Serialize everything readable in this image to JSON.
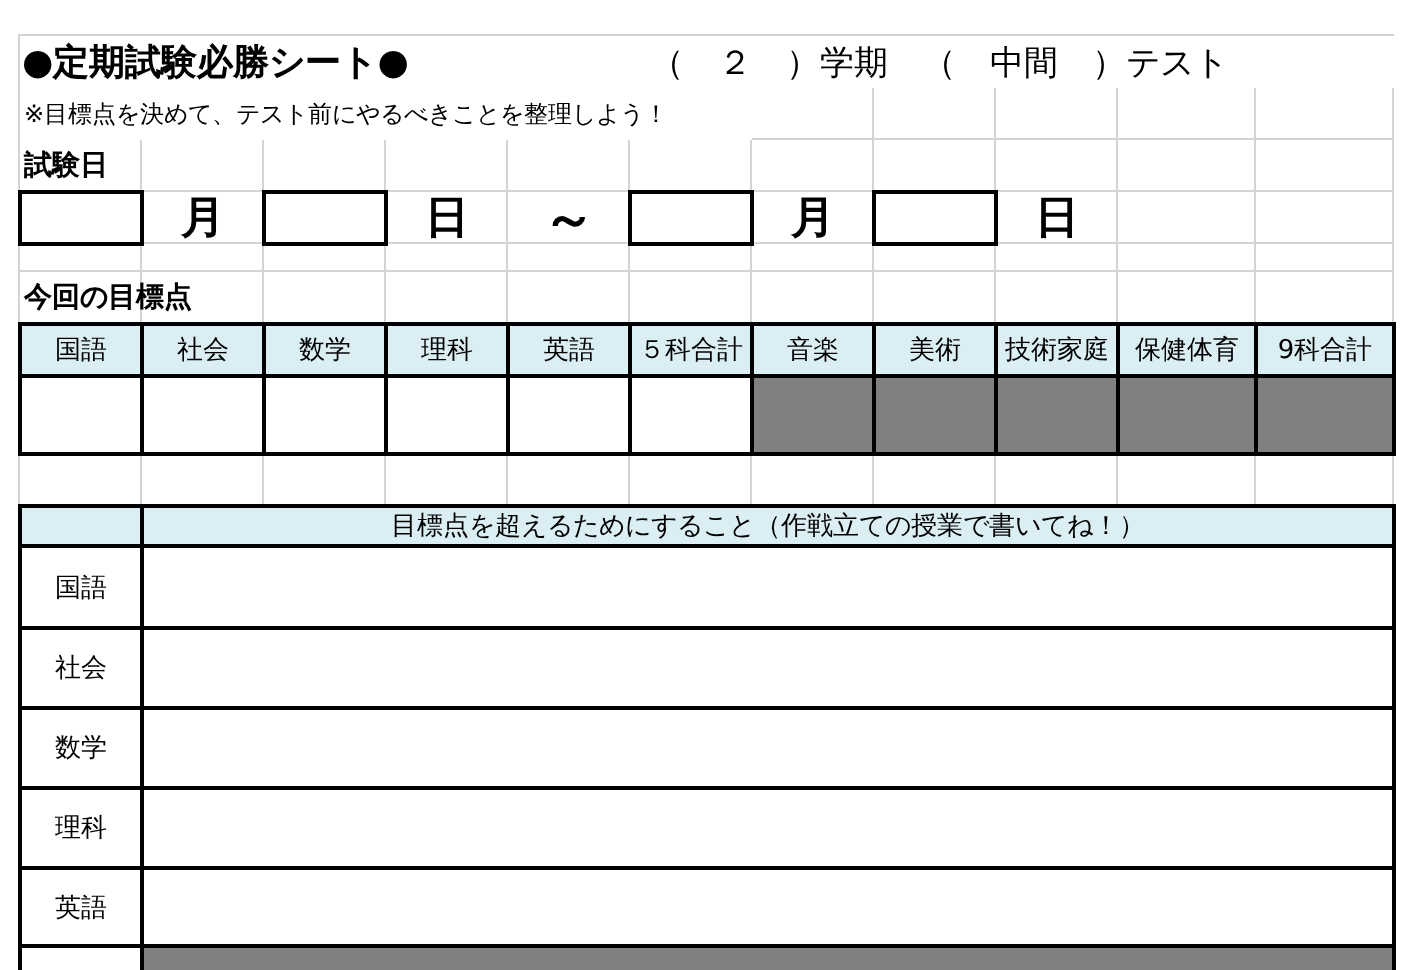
{
  "title": "●定期試験必勝シート●",
  "term_line": "（　２　）学期　（　中間　）テスト",
  "note": "※目標点を決めて、テスト前にやるべきことを整理しよう！",
  "exam_date": {
    "label": "試験日",
    "parts": [
      {
        "kind": "field"
      },
      {
        "kind": "label",
        "text": "月"
      },
      {
        "kind": "field"
      },
      {
        "kind": "label",
        "text": "日"
      },
      {
        "kind": "tilde",
        "text": "～"
      },
      {
        "kind": "field"
      },
      {
        "kind": "label",
        "text": "月"
      },
      {
        "kind": "field"
      },
      {
        "kind": "label",
        "text": "日"
      }
    ]
  },
  "target": {
    "label": "今回の目標点",
    "columns": [
      {
        "label": "国語",
        "disabled": false
      },
      {
        "label": "社会",
        "disabled": false
      },
      {
        "label": "数学",
        "disabled": false
      },
      {
        "label": "理科",
        "disabled": false
      },
      {
        "label": "英語",
        "disabled": false
      },
      {
        "label": "５科合計",
        "disabled": false
      },
      {
        "label": "音楽",
        "disabled": true
      },
      {
        "label": "美術",
        "disabled": true
      },
      {
        "label": "技術家庭",
        "disabled": true
      },
      {
        "label": "保健体育",
        "disabled": true
      },
      {
        "label": "9科合計",
        "disabled": true
      }
    ]
  },
  "plan": {
    "header": "目標点を超えるためにすること（作戦立ての授業で書いてね！）",
    "rows": [
      {
        "subject": "国語",
        "disabled": false
      },
      {
        "subject": "社会",
        "disabled": false
      },
      {
        "subject": "数学",
        "disabled": false
      },
      {
        "subject": "理科",
        "disabled": false
      },
      {
        "subject": "英語",
        "disabled": false
      },
      {
        "disabled": true
      }
    ]
  }
}
